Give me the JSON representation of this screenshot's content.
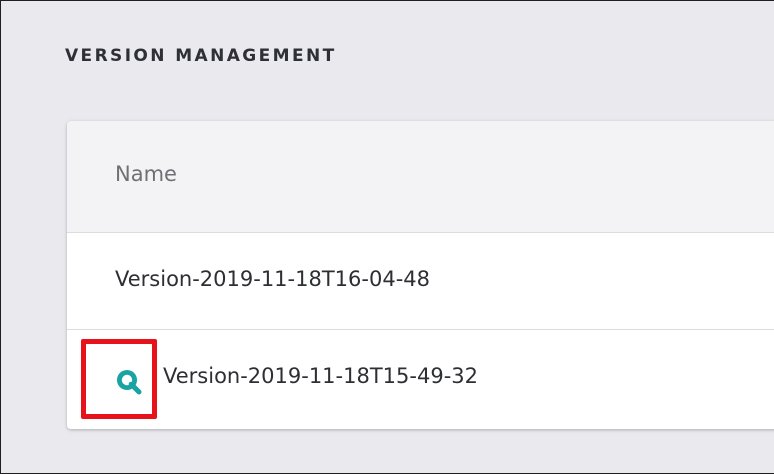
{
  "section": {
    "title": "VERSION MANAGEMENT"
  },
  "table": {
    "columns": [
      "Name"
    ],
    "rows": [
      {
        "name": "Version-2019-11-18T16-04-48"
      },
      {
        "name": "Version-2019-11-18T15-49-32"
      }
    ]
  },
  "icons": {
    "preview_icon": "magnifier-search-icon"
  },
  "colors": {
    "accent": "#1aa3a3",
    "highlight": "#e8121a",
    "page_bg": "#e9e9ee"
  }
}
